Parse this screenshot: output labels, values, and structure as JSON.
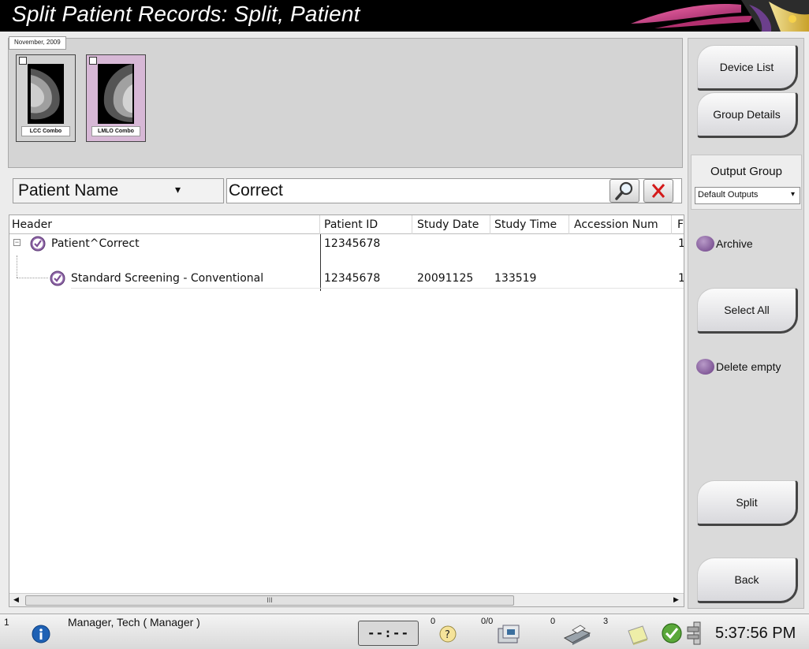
{
  "window": {
    "title": "Split Patient Records: Split, Patient"
  },
  "thumbnails": {
    "tab_label": "November, 2009",
    "items": [
      {
        "caption": "LCC Combo",
        "selected": false
      },
      {
        "caption": "LMLO Combo",
        "selected": true
      }
    ]
  },
  "search": {
    "field_selector": "Patient Name",
    "query": "Correct"
  },
  "table": {
    "columns": [
      "Header",
      "Patient ID",
      "Study Date",
      "Study Time",
      "Accession Num",
      "F"
    ],
    "rows": [
      {
        "header": "Patient^Correct",
        "patient_id": "12345678",
        "study_date": "",
        "study_time": "",
        "accession": "",
        "last": "1"
      },
      {
        "header": "Standard Screening - Conventional",
        "patient_id": "12345678",
        "study_date": "20091125",
        "study_time": "133519",
        "accession": "",
        "last": "1"
      }
    ],
    "scroll_thumb_label": "III"
  },
  "right_panel": {
    "device_list": "Device List",
    "group_details": "Group Details",
    "output_group_label": "Output Group",
    "output_group_value": "Default Outputs",
    "archive_label": "Archive",
    "select_all": "Select All",
    "delete_empty_label": "Delete empty",
    "split": "Split",
    "back": "Back"
  },
  "status_bar": {
    "index": "1",
    "user": "Manager, Tech ( Manager )",
    "clock_display": "--:--",
    "queries_count": "0",
    "print_jobs": "0/0",
    "devices_count": "0",
    "scanner_count": "3",
    "time": "5:37:56 PM"
  },
  "colors": {
    "accent_purple": "#7d4f96",
    "selected_thumb": "#d7b8d6",
    "close_red": "#d41a1a"
  }
}
